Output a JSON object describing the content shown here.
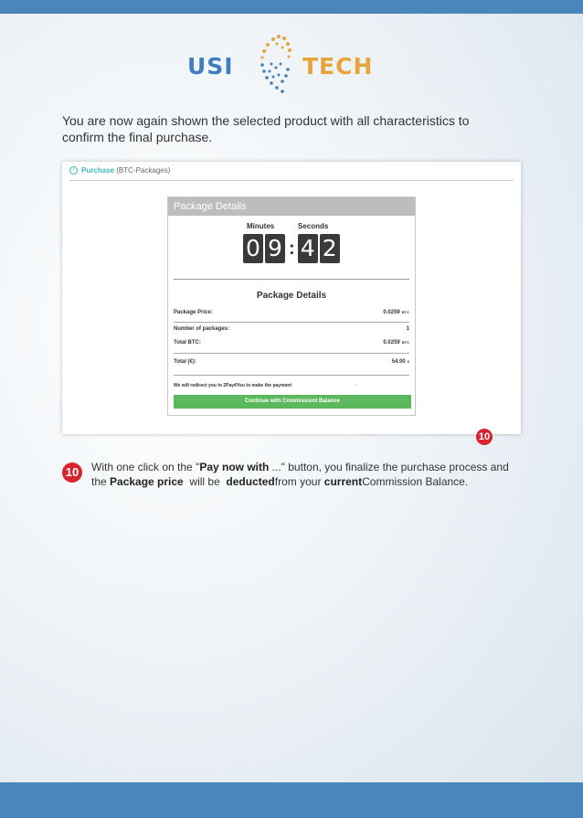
{
  "logo": {
    "left_text": "USI",
    "right_text": "TECH"
  },
  "intro": "You are now again shown the selected product with all characteristics to confirm the final purchase.",
  "screenshot": {
    "breadcrumb": {
      "link": "Purchase",
      "rest": "(BTC-Packages)"
    },
    "panel_title": "Package Details",
    "timer": {
      "minutes_label": "Minutes",
      "seconds_label": "Seconds",
      "digits": [
        "0",
        "9",
        "4",
        "2"
      ]
    },
    "details_title": "Package Details",
    "rows": [
      {
        "label": "Package Price:",
        "value": "0.0259",
        "unit": "BTC"
      },
      {
        "label": "Number of packages:",
        "value": "1",
        "unit": ""
      },
      {
        "label": "Total BTC:",
        "value": "0.0259",
        "unit": "BTC"
      },
      {
        "label": "Total (€):",
        "value": "54.00",
        "unit": "€"
      }
    ],
    "redirect_text": "We will redirect you to 2Pay4You to make the payment",
    "redirect_dot": ".",
    "button_label": "Continue with Commissiont Balance",
    "badge": "10"
  },
  "instruction": {
    "badge": "10",
    "parts": [
      "With one click on the \"",
      "Pay now with",
      " ...\" button, you finalize the purchase process and the ",
      "Package price",
      "  will be  ",
      "deducted",
      "from your ",
      "current",
      "Commission Balance."
    ]
  },
  "colors": {
    "bar": "#4a85bc",
    "accent": "#3cb8c4",
    "button": "#5cb85c",
    "badge": "#d8242c"
  }
}
